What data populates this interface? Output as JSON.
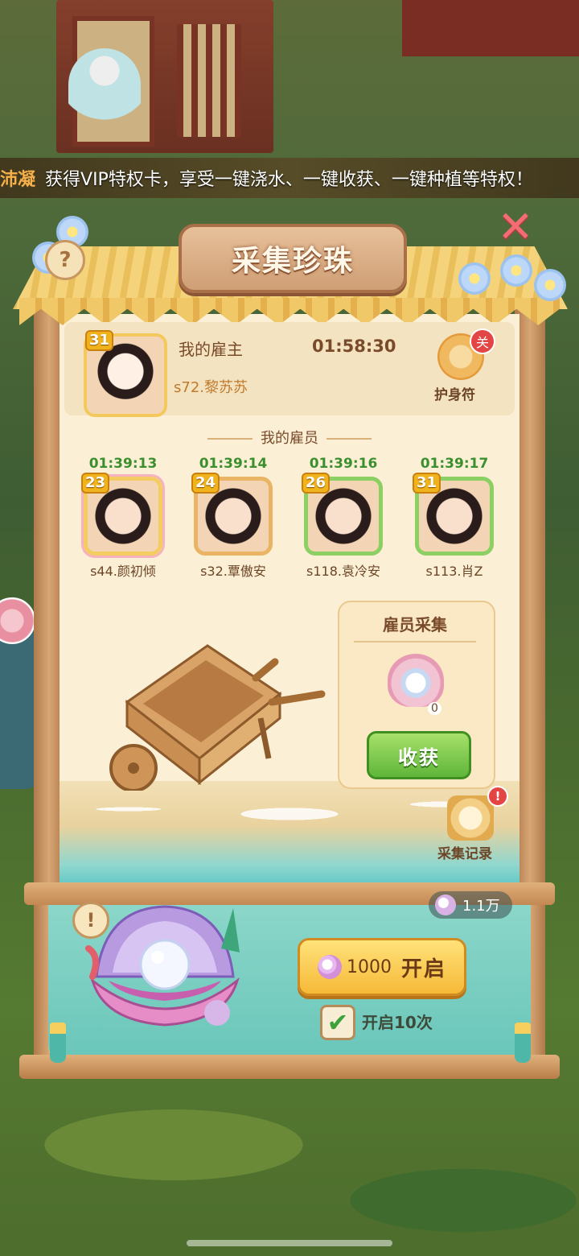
{
  "marquee": {
    "name": "沛凝",
    "message": "获得VIP特权卡，享受一键浇水、一键收获、一键种植等特权！"
  },
  "panel": {
    "title": "采集珍珠"
  },
  "employer": {
    "level": "31",
    "label": "我的雇主",
    "timer": "01:58:30",
    "name": "s72.黎苏苏",
    "charm_label": "护身符",
    "charm_badge": "关"
  },
  "employees": {
    "header": "我的雇员",
    "items": [
      {
        "level": "23",
        "timer": "01:39:13",
        "name": "s44.颜初倾"
      },
      {
        "level": "24",
        "timer": "01:39:14",
        "name": "s32.覃傲安"
      },
      {
        "level": "26",
        "timer": "01:39:16",
        "name": "s118.袁冷安"
      },
      {
        "level": "31",
        "timer": "01:39:17",
        "name": "s113.肖Z"
      }
    ]
  },
  "collect": {
    "title": "雇员采集",
    "count": "0",
    "harvest_label": "收获"
  },
  "record": {
    "label": "采集记录",
    "badge": "!"
  },
  "bottom": {
    "info": "!",
    "pearl_balance": "1.1万",
    "open_cost": "1000",
    "open_label": "开启",
    "check_label": "开启10次",
    "check_mark": "✔"
  },
  "help": "?",
  "close": "✕",
  "colors": {
    "accent": "#f6b938",
    "green": "#5fb63a",
    "teal": "#67c5b8",
    "timer_green": "#3c8f2f"
  }
}
